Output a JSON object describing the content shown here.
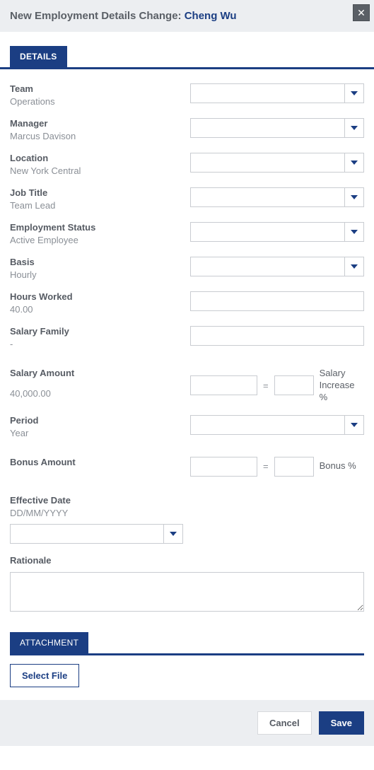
{
  "header": {
    "title_prefix": "New Employment Details Change: ",
    "employee_name": "Cheng Wu"
  },
  "tabs": {
    "details": "DETAILS",
    "attachment": "ATTACHMENT"
  },
  "fields": {
    "team": {
      "label": "Team",
      "current": "Operations",
      "value": ""
    },
    "manager": {
      "label": "Manager",
      "current": "Marcus Davison",
      "value": ""
    },
    "location": {
      "label": "Location",
      "current": "New York Central",
      "value": ""
    },
    "job_title": {
      "label": "Job Title",
      "current": "Team Lead",
      "value": ""
    },
    "emp_status": {
      "label": "Employment Status",
      "current": "Active Employee",
      "value": ""
    },
    "basis": {
      "label": "Basis",
      "current": "Hourly",
      "value": ""
    },
    "hours": {
      "label": "Hours Worked",
      "current": "40.00",
      "value": ""
    },
    "salary_family": {
      "label": "Salary Family",
      "current": "-",
      "value": ""
    },
    "salary_amount": {
      "label": "Salary Amount",
      "current": "40,000.00",
      "value": "",
      "increase_value": "",
      "suffix1": "Salary Increase",
      "suffix2": "%",
      "equals": "="
    },
    "period": {
      "label": "Period",
      "current": "Year",
      "value": ""
    },
    "bonus_amount": {
      "label": "Bonus Amount",
      "current": "",
      "value": "",
      "bonus_pct_value": "",
      "suffix": "Bonus %",
      "equals": "="
    },
    "effective_date": {
      "label": "Effective Date",
      "placeholder": "DD/MM/YYYY",
      "value": ""
    },
    "rationale": {
      "label": "Rationale",
      "value": ""
    }
  },
  "buttons": {
    "select_file": "Select File",
    "cancel": "Cancel",
    "save": "Save"
  }
}
